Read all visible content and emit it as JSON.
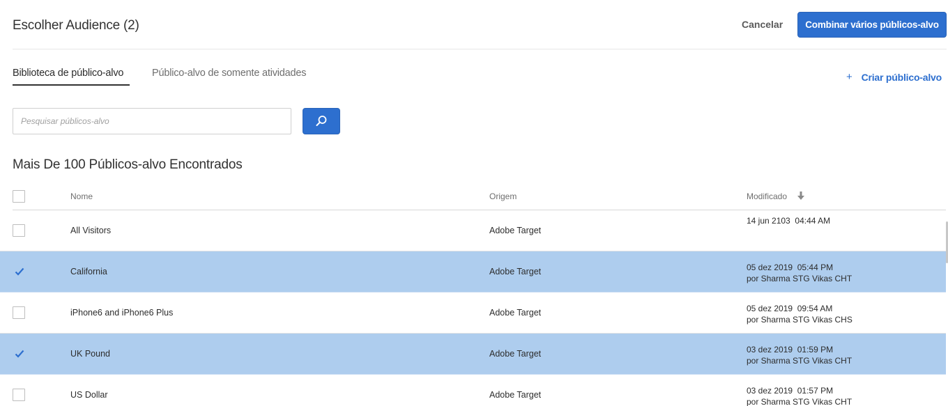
{
  "header": {
    "title": "Escolher Audience (2)",
    "cancel_label": "Cancelar",
    "combine_label": "Combinar vários públicos-alvo"
  },
  "tabs": [
    {
      "label": "Biblioteca de público-alvo",
      "active": true
    },
    {
      "label": "Público-alvo de somente atividades",
      "active": false
    }
  ],
  "create_link": {
    "icon": "plus",
    "label": "Criar público-alvo"
  },
  "search": {
    "placeholder": "Pesquisar públicos-alvo",
    "value": "",
    "button_icon": "search-icon"
  },
  "results_title": "Mais De 100 Públicos-alvo Encontrados",
  "table": {
    "columns": {
      "name": "Nome",
      "origin": "Origem",
      "modified": "Modificado"
    },
    "sort_icon": "arrow-down-icon",
    "rows": [
      {
        "name": "All Visitors",
        "origin": "Adobe Target",
        "modified": "14 jun 2103  04:44 AM",
        "modified_by": "",
        "selected": false
      },
      {
        "name": "California",
        "origin": "Adobe Target",
        "modified": "05 dez 2019  05:44 PM",
        "modified_by": "por Sharma STG Vikas CHT",
        "selected": true
      },
      {
        "name": "iPhone6 and iPhone6 Plus",
        "origin": "Adobe Target",
        "modified": "05 dez 2019  09:54 AM",
        "modified_by": "por Sharma STG Vikas CHS",
        "selected": false
      },
      {
        "name": "UK Pound",
        "origin": "Adobe Target",
        "modified": "03 dez 2019  01:59 PM",
        "modified_by": "por Sharma STG Vikas CHT",
        "selected": true
      },
      {
        "name": "US Dollar",
        "origin": "Adobe Target",
        "modified": "03 dez 2019  01:57 PM",
        "modified_by": "por Sharma STG Vikas CHT",
        "selected": false
      }
    ]
  },
  "colors": {
    "accent": "#2d6fcf",
    "selected_row": "#aecdee",
    "check": "#2d6fcf"
  }
}
